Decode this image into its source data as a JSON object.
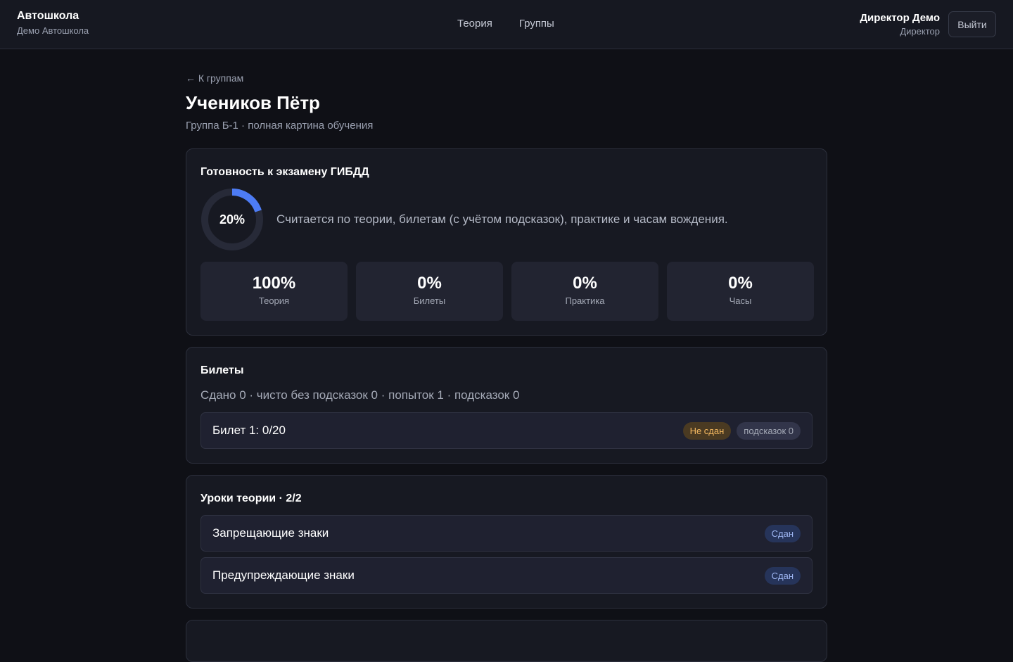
{
  "header": {
    "brand_title": "Автошкола",
    "brand_subtitle": "Демо Автошкола",
    "nav": [
      {
        "label": "Теория"
      },
      {
        "label": "Группы"
      }
    ],
    "user_name": "Директор Демо",
    "user_role": "Директор",
    "logout_label": "Выйти"
  },
  "page": {
    "back_link": "← К группам",
    "title": "Учеников Пётр",
    "subtitle": "Группа Б-1 · полная картина обучения"
  },
  "readiness": {
    "title": "Готовность к экзамену ГИБДД",
    "percent_label": "20%",
    "progress": 0.2,
    "note": "Считается по теории, билетам (с учётом подсказок), практике и часам вождения.",
    "stats": [
      {
        "value": "100%",
        "label": "Теория"
      },
      {
        "value": "0%",
        "label": "Билеты"
      },
      {
        "value": "0%",
        "label": "Практика"
      },
      {
        "value": "0%",
        "label": "Часы"
      }
    ]
  },
  "tickets": {
    "title": "Билеты",
    "summary": "Сдано 0 · чисто без подсказок 0 · попыток 1 · подсказок 0",
    "items": [
      {
        "label": "Билет 1: 0/20",
        "status": "Не сдан",
        "hints": "подсказок 0"
      }
    ]
  },
  "lessons": {
    "title": "Уроки теории · 2/2",
    "items": [
      {
        "label": "Запрещающие знаки",
        "status": "Сдан"
      },
      {
        "label": "Предупреждающие знаки",
        "status": "Сдан"
      }
    ]
  },
  "colors": {
    "background": "#0f1016",
    "card": "#171922",
    "accent": "#4d7cf5",
    "warning": "#f4b860"
  }
}
